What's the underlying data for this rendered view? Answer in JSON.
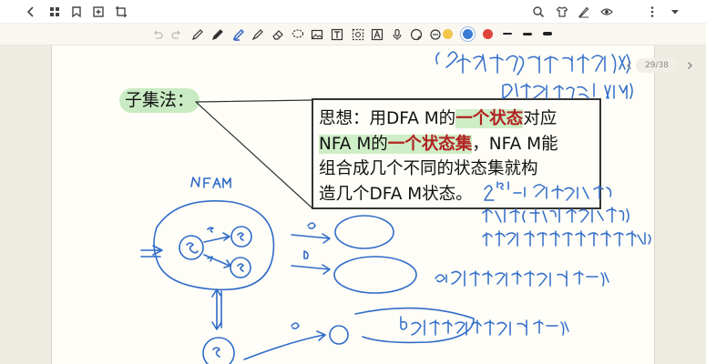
{
  "header": {
    "icons": [
      "back-icon",
      "grid-icon",
      "bookmark-icon",
      "add-page-icon",
      "crop-icon",
      "search-icon",
      "shirt-icon",
      "pen-icon",
      "view-icon",
      "more-icon",
      "dropdown-icon"
    ]
  },
  "toolbar": {
    "tools": [
      "undo-icon",
      "redo-icon",
      "pen-icon",
      "pencil-icon",
      "highlighter-icon",
      "eraser-icon",
      "lasso-icon",
      "image-icon",
      "text-icon",
      "ocr-icon",
      "mic-icon",
      "sticker-icon",
      "shape-icon"
    ],
    "colors": [
      "#f2c64a",
      "#3a7bd5",
      "#e0423c"
    ]
  },
  "page": {
    "heading": "子集法：",
    "box": {
      "line1_prefix": "思想：用DFA M的",
      "line1_emph": "一个状态",
      "line1_suffix": "对应",
      "line2_prefix": "NFA M的",
      "line2_emph": "一个状态集",
      "line2_suffix": "，NFA M能",
      "line3": "组合成几个不同的状态集就构",
      "line4": "造几个DFA M状态。"
    },
    "page_indicator": "29/38"
  }
}
